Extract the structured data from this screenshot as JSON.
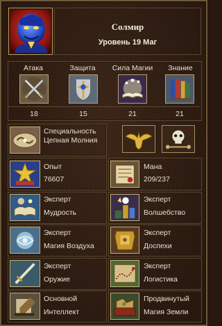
{
  "hero": {
    "name": "Солмир",
    "level_text": "Уровень 19 Маг"
  },
  "primary_skills": [
    {
      "label": "Атака",
      "value": "18",
      "icon": "crossed-swords-icon"
    },
    {
      "label": "Защита",
      "value": "15",
      "icon": "shield-icon"
    },
    {
      "label": "Сила Магии",
      "value": "21",
      "icon": "spellbook-icon"
    },
    {
      "label": "Знание",
      "value": "21",
      "icon": "books-icon"
    }
  ],
  "specialty": {
    "label": "Специальность",
    "value": "Цепная Молния",
    "icon": "chain-lightning-scroll-icon"
  },
  "morale_icon": "eagle-morale-icon",
  "luck_icon": "skull-luck-icon",
  "experience": {
    "label": "Опыт",
    "value": "76607",
    "icon": "star-experience-icon"
  },
  "mana": {
    "label": "Мана",
    "value": "209/237",
    "icon": "mana-scroll-icon"
  },
  "secondary_skills": [
    {
      "level": "Эксперт",
      "name": "Мудрость",
      "icon": "wisdom-icon"
    },
    {
      "level": "Эксперт",
      "name": "Волшебство",
      "icon": "sorcery-icon"
    },
    {
      "level": "Эксперт",
      "name": "Магия Воздуха",
      "icon": "air-magic-icon"
    },
    {
      "level": "Эксперт",
      "name": "Доспехи",
      "icon": "armorer-icon"
    },
    {
      "level": "Эксперт",
      "name": "Оружие",
      "icon": "offense-sword-icon"
    },
    {
      "level": "Эксперт",
      "name": "Логистика",
      "icon": "logistics-map-icon"
    },
    {
      "level": "Основной",
      "name": "Интеллект",
      "icon": "intelligence-icon"
    },
    {
      "level": "Продвинутый",
      "name": "Магия Земли",
      "icon": "earth-magic-icon"
    }
  ],
  "colors": {
    "text": "#e8e2cf",
    "frame": "#8a744e",
    "background": "#2c1a10"
  }
}
